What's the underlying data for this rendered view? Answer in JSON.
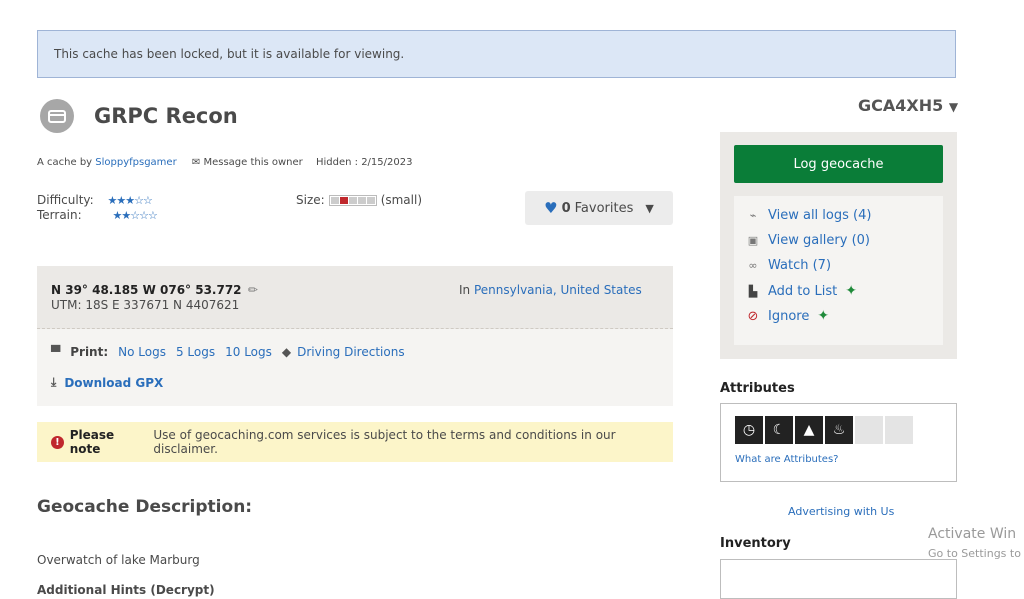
{
  "banner": {
    "text": "This cache has been locked, but it is available for viewing."
  },
  "cache": {
    "title": "GRPC Recon",
    "code": "GCA4XH5",
    "by_prefix": "A cache by",
    "owner": "Sloppyfpsgamer",
    "message_owner": "Message this owner",
    "hidden": "Hidden : 2/15/2023",
    "difficulty_label": "Difficulty:",
    "difficulty_stars": "★★★☆☆",
    "terrain_label": "Terrain:",
    "terrain_stars": "★★☆☆☆",
    "size_label": "Size:",
    "size_value": "(small)",
    "size_level": 0.4,
    "favorites_count": "0",
    "favorites_label": "Favorites"
  },
  "coords": {
    "latlon": "N 39° 48.185 W 076° 53.772",
    "utm": "UTM: 18S E 337671 N 4407621",
    "in_prefix": "In",
    "location": "Pennsylvania, United States"
  },
  "print": {
    "label": "Print:",
    "no_logs": "No Logs",
    "five_logs": "5 Logs",
    "ten_logs": "10 Logs",
    "driving": "Driving Directions",
    "gpx": "Download GPX"
  },
  "note": {
    "bold": "Please note",
    "text": "Use of geocaching.com services is subject to the terms and conditions in our disclaimer."
  },
  "description": {
    "heading": "Geocache Description:",
    "text": "Overwatch of lake Marburg",
    "hints": "Additional Hints (Decrypt)"
  },
  "sidebar": {
    "log_button": "Log geocache",
    "view_logs": "View all logs (4)",
    "view_gallery": "View gallery (0)",
    "watch": "Watch (7)",
    "add_to_list": "Add to List",
    "ignore": "Ignore"
  },
  "attributes": {
    "heading": "Attributes",
    "link": "What are Attributes?",
    "icons": [
      "clock-icon",
      "night-icon",
      "tent-icon",
      "campfire-icon"
    ]
  },
  "advertising": "Advertising with Us",
  "inventory": {
    "heading": "Inventory"
  },
  "watermark": {
    "line1": "Activate Win",
    "line2": "Go to Settings to"
  }
}
